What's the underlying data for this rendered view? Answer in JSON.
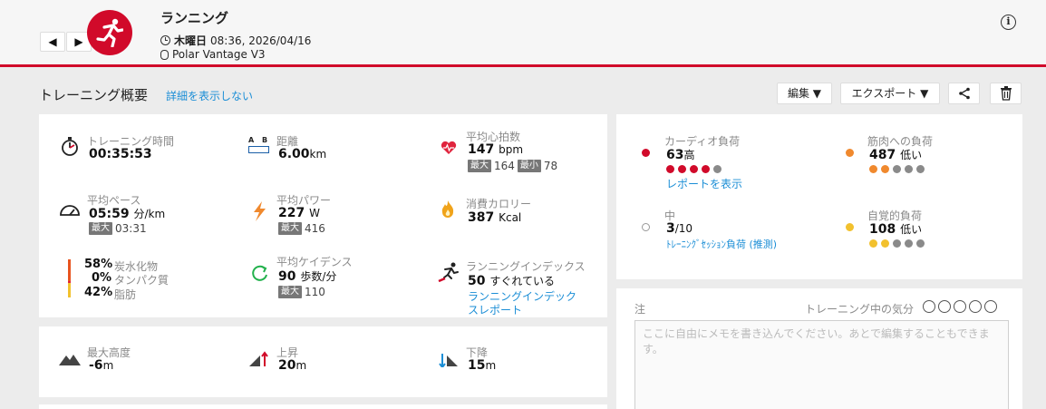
{
  "header": {
    "title": "ランニング",
    "weekday": "木曜日",
    "datetime": "08:36, 2026/04/16",
    "device": "Polar Vantage V3",
    "prev_label": "◀",
    "next_label": "▶",
    "info_label": "i"
  },
  "summary": {
    "title": "トレーニング概要",
    "hide_details": "詳細を表示しない",
    "edit": "編集 ▼",
    "export": "エクスポート ▼"
  },
  "metrics": {
    "duration": {
      "label": "トレーニング時間",
      "value": "00:35:53"
    },
    "distance": {
      "label": "距離",
      "value": "6.00",
      "unit": "km",
      "icon_text_a": "A",
      "icon_text_b": "B"
    },
    "heart_rate": {
      "label": "平均心拍数",
      "value": "147",
      "unit": "bpm",
      "max_tag": "最大",
      "max": "164",
      "min_tag": "最小",
      "min": "78"
    },
    "pace": {
      "label": "平均ペース",
      "value": "05:59",
      "unit": "分/km",
      "max_tag": "最大",
      "max": "03:31"
    },
    "power": {
      "label": "平均パワー",
      "value": "227",
      "unit": "W",
      "max_tag": "最大",
      "max": "416"
    },
    "calories": {
      "label": "消費カロリー",
      "value": "387",
      "unit": "Kcal"
    },
    "carbs": {
      "pct": "58%",
      "label": "炭水化物"
    },
    "protein": {
      "pct": "0%",
      "label": "タンパク質"
    },
    "fat": {
      "pct": "42%",
      "label": "脂肪"
    },
    "cadence": {
      "label": "平均ケイデンス",
      "value": "90",
      "unit": "歩数/分",
      "max_tag": "最大",
      "max": "110"
    },
    "running_index": {
      "label": "ランニングインデックス",
      "value": "50",
      "desc": "すぐれている",
      "link1": "ランニングインデック",
      "link2": "スレポート"
    }
  },
  "elevation": {
    "max_alt": {
      "label": "最大高度",
      "value": "-6",
      "unit": "m"
    },
    "ascent": {
      "label": "上昇",
      "value": "20",
      "unit": "m"
    },
    "descent": {
      "label": "下降",
      "value": "15",
      "unit": "m"
    }
  },
  "load": {
    "cardio": {
      "label": "カーディオ負荷",
      "value": "63",
      "level": "高",
      "link": "レポートを表示",
      "dots_filled": 4,
      "dots_total": 5,
      "color": "#d10a2a"
    },
    "muscle": {
      "label": "筋肉への負荷",
      "value": "487",
      "level": "低い",
      "dots_filled": 2,
      "dots_total": 5,
      "color": "#f0892e"
    },
    "session": {
      "label": "中",
      "value": "3",
      "unit": "/10",
      "link": "ﾄﾚｰﾆﾝｸﾞｾｯｼｮﾝ負荷 (推測)"
    },
    "perceived": {
      "label": "自覚的負荷",
      "value": "108",
      "level": "低い",
      "dots_filled": 2,
      "dots_total": 5,
      "color": "#f2c12e"
    }
  },
  "notes": {
    "label": "注",
    "mood_label": "トレーニング中の気分",
    "placeholder": "ここに自由にメモを書き込んでください。あとで編集することもできます。"
  }
}
